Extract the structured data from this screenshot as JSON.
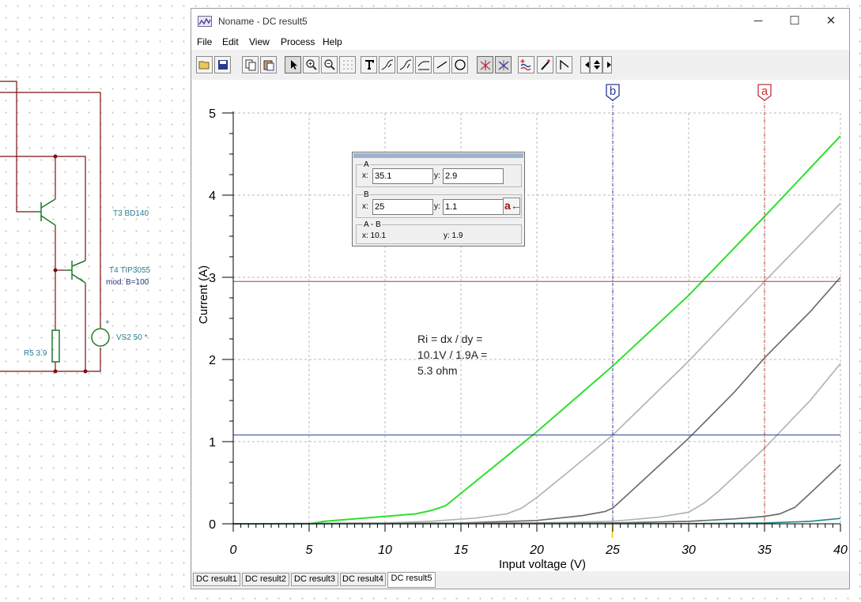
{
  "window": {
    "title": "Noname - DC result5",
    "controls": {
      "minimize": "─",
      "maximize": "☐",
      "close": "✕"
    }
  },
  "menu": [
    "File",
    "Edit",
    "View",
    "Process",
    "Help"
  ],
  "toolbar_icons": [
    "open-icon",
    "save-icon",
    "copy-icon",
    "paste-icon",
    "pointer-icon",
    "zoom-in-icon",
    "zoom-out-icon",
    "grid-icon",
    "text-icon",
    "curve-tool-icon",
    "curve-tool-2-icon",
    "curve-tool-3-icon",
    "line-icon",
    "circle-icon",
    "cursor-a-icon",
    "cursor-b-icon",
    "wave-add-icon",
    "probe-icon",
    "step-icon",
    "arrow-left-icon",
    "updown-icon",
    "arrow-right-icon"
  ],
  "schematic": {
    "labels": {
      "t3": "T3 BD140",
      "t4": "T4 TIP3055",
      "t4_model": "mod: B=100",
      "vs2": "VS2 50 *",
      "r5": "R5 3.9",
      "plus": "+"
    }
  },
  "cursor_panel": {
    "a_title": "A",
    "a_x": "35.1",
    "a_y": "2.9",
    "b_title": "B",
    "b_x": "25",
    "b_y": "1.1",
    "diff_title": "A - B",
    "diff_x": "x:  10.1",
    "diff_y": "y: 1.9",
    "x_label": "x:",
    "y_label": "y:",
    "set_b_label": "a←"
  },
  "annotation": [
    "Ri = dx / dy =",
    "10.1V / 1.9A =",
    "5.3 ohm"
  ],
  "tabs": [
    "DC result1",
    "DC result2",
    "DC result3",
    "DC result4",
    "DC result5"
  ],
  "active_tab": 4,
  "colors": {
    "curve_main": "#2de02d",
    "curve_light": "#b4b4b4",
    "curve_dark": "#6e6e6e",
    "curve_teal": "#2a8a8a",
    "cursor_a": "#c83232",
    "cursor_b": "#2a3a9a"
  },
  "chart_data": {
    "type": "line",
    "xlabel": "Input voltage (V)",
    "ylabel": "Current (A)",
    "xlim": [
      0,
      40
    ],
    "ylim": [
      0,
      5
    ],
    "xticks": [
      0,
      5,
      10,
      15,
      20,
      25,
      30,
      35,
      40
    ],
    "yticks": [
      0,
      1,
      2,
      3,
      4,
      5
    ],
    "grid": true,
    "cursors": {
      "a": {
        "label": "a",
        "x": 35,
        "y": 2.95
      },
      "b": {
        "label": "b",
        "x": 25,
        "y": 1.08
      }
    },
    "series": [
      {
        "color": "#2de02d",
        "x": [
          0,
          5,
          6,
          8,
          10,
          12,
          13,
          14,
          16,
          18,
          20,
          25,
          30,
          35,
          40
        ],
        "y": [
          0,
          0,
          0.03,
          0.06,
          0.09,
          0.12,
          0.16,
          0.22,
          0.52,
          0.82,
          1.12,
          1.92,
          2.78,
          3.74,
          4.72
        ]
      },
      {
        "color": "#b4b4b4",
        "x": [
          0,
          10,
          13,
          16,
          18,
          19,
          20,
          22,
          25,
          30,
          35,
          40
        ],
        "y": [
          0,
          0.01,
          0.03,
          0.07,
          0.12,
          0.19,
          0.32,
          0.62,
          1.08,
          1.98,
          2.95,
          3.9
        ]
      },
      {
        "color": "#6e6e6e",
        "x": [
          0,
          15,
          20,
          23,
          24.5,
          25,
          26,
          28,
          30,
          33,
          35,
          38,
          40
        ],
        "y": [
          0,
          0.01,
          0.04,
          0.1,
          0.15,
          0.19,
          0.36,
          0.7,
          1.04,
          1.6,
          2.02,
          2.58,
          3.0
        ]
      },
      {
        "color": "#b4b4b4",
        "x": [
          0,
          20,
          25,
          28,
          30,
          31,
          32,
          35,
          38,
          40
        ],
        "y": [
          0,
          0.01,
          0.03,
          0.08,
          0.14,
          0.25,
          0.4,
          0.92,
          1.5,
          1.95
        ]
      },
      {
        "color": "#6e6e6e",
        "x": [
          0,
          25,
          30,
          33,
          35,
          36,
          37,
          38,
          40
        ],
        "y": [
          0,
          0.01,
          0.03,
          0.06,
          0.09,
          0.12,
          0.2,
          0.37,
          0.72
        ]
      },
      {
        "color": "#2a8a8a",
        "x": [
          0,
          30,
          35,
          38,
          40
        ],
        "y": [
          0,
          0.003,
          0.01,
          0.03,
          0.065
        ]
      }
    ]
  }
}
